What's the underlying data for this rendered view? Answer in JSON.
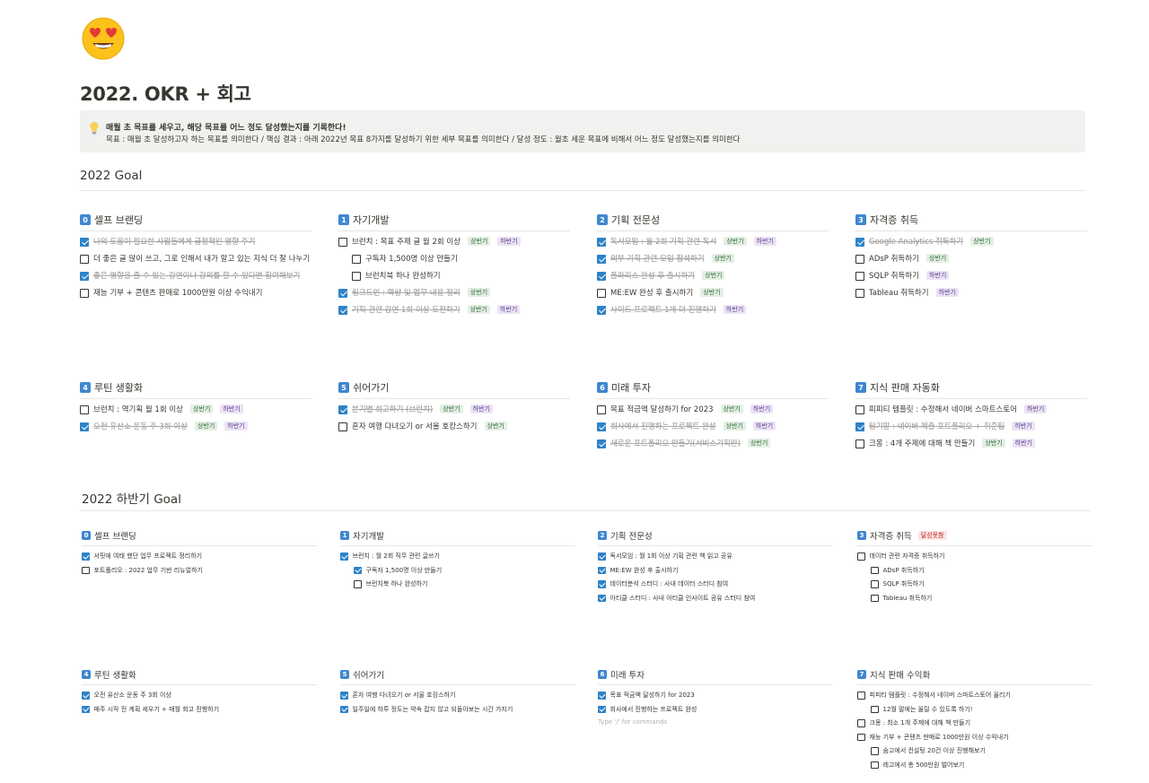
{
  "page": {
    "title": "2022. OKR + 회고",
    "icon": "heart-eyes-emoji"
  },
  "callout": {
    "icon": "lightbulb-icon",
    "line1": "매월 초 목표를 세우고, 해당 목표를 어느 정도 달성했는지를 기록한다!",
    "line2": "목표 : 매월 초 달성하고자 하는 목표를 의미한다 / 핵심 결과 : 아래 2022년 목표 8가지를 달성하기 위한 세부 목표를 의미한다 / 달성 정도 : 월초 세운 목표에 비해서 어느 정도 달성했는지를 의미한다"
  },
  "tags": {
    "first": "상반기",
    "second": "하반기",
    "fail": "달성못함"
  },
  "goal": {
    "title": "2022 Goal",
    "columns": [
      {
        "num": "0",
        "title": "셀프 브랜딩",
        "items": [
          {
            "text": "나의 도움이 필요한 사람들에게 긍정적인 영향 주기",
            "checked": true
          },
          {
            "text": "더 좋은 글 많이 쓰고, 그로 인해서 내가 알고 있는 지식 더 잘 나누기",
            "checked": false
          },
          {
            "text": "좋은 영향을 줄 수 있는 강연이나 강의를 할 수 있다면 참여해보기",
            "checked": true
          },
          {
            "text": "재능 기부 + 콘텐츠 판매로 1000만원 이상 수익내기",
            "checked": false
          }
        ]
      },
      {
        "num": "1",
        "title": "자기개발",
        "items": [
          {
            "text": "브런치 : 목표 주제 글 월 2회 이상",
            "checked": false,
            "tags": [
              "first",
              "second"
            ]
          },
          {
            "text": "구독자 1,500명 이상 만들기",
            "checked": false,
            "indent": true
          },
          {
            "text": "브런치북 하나 완성하기",
            "checked": false,
            "indent": true
          },
          {
            "text": "링크드인 : 역량 및 업무 내용 정리",
            "checked": true,
            "tags": [
              "first"
            ]
          },
          {
            "text": "기획 관련 강연 1회 이상 도전하기",
            "checked": true,
            "tags": [
              "first",
              "second"
            ]
          }
        ]
      },
      {
        "num": "2",
        "title": "기획 전문성",
        "items": [
          {
            "text": "독서모임 : 월 2회 기획 관련 독서",
            "checked": true,
            "tags": [
              "first",
              "second"
            ]
          },
          {
            "text": "외부 기획 관련 모임 참석하기",
            "checked": true,
            "tags": [
              "first"
            ]
          },
          {
            "text": "폴라리스 완성 후 출시하기",
            "checked": true,
            "tags": [
              "first"
            ]
          },
          {
            "text": "ME:EW 완성 후 출시하기",
            "checked": false,
            "tags": [
              "first"
            ]
          },
          {
            "text": "사이드 프로젝트 1개 더 진행하기",
            "checked": true,
            "tags": [
              "second"
            ]
          }
        ]
      },
      {
        "num": "3",
        "title": "자격증 취득",
        "items": [
          {
            "text": "Google Analytics 취득하기",
            "checked": true,
            "tags": [
              "first"
            ]
          },
          {
            "text": "ADsP 취득하기",
            "checked": false,
            "tags": [
              "first"
            ]
          },
          {
            "text": "SQLP 취득하기",
            "checked": false,
            "tags": [
              "second"
            ]
          },
          {
            "text": "Tableau 취득하기",
            "checked": false,
            "tags": [
              "second"
            ]
          }
        ]
      },
      {
        "num": "4",
        "title": "루틴 생활화",
        "items": [
          {
            "text": "브런치 : 역기획 월 1회 이상",
            "checked": false,
            "tags": [
              "first",
              "second"
            ]
          },
          {
            "text": "오전 유산소 운동 주 3회 이상",
            "checked": true,
            "tags": [
              "first",
              "second"
            ]
          }
        ]
      },
      {
        "num": "5",
        "title": "쉬어가기",
        "items": [
          {
            "text": "분기별 회고하기 (브런치)",
            "checked": true,
            "tags": [
              "first",
              "second"
            ]
          },
          {
            "text": "혼자 여행 다녀오기 or 서울 호캉스하기",
            "checked": false,
            "tags": [
              "first"
            ]
          }
        ]
      },
      {
        "num": "6",
        "title": "미래 투자",
        "items": [
          {
            "text": "목표 적금액 달성하기 for 2023",
            "checked": false,
            "tags": [
              "first",
              "second"
            ]
          },
          {
            "text": "회사에서 진행하는 프로젝트 완성",
            "checked": true,
            "tags": [
              "first",
              "second"
            ]
          },
          {
            "text": "새로운 포트폴리오 만들기(서비스기획만)",
            "checked": true,
            "tags": [
              "first"
            ]
          }
        ]
      },
      {
        "num": "7",
        "title": "지식 판매 자동화",
        "items": [
          {
            "text": "피피티 템플릿 : 수정해서 네이버 스마트스토어",
            "checked": false,
            "tags": [
              "second"
            ]
          },
          {
            "text": "탐기말 : 네이버 제출 포트폴리오 + 취준팁",
            "checked": true,
            "tags": [
              "second"
            ]
          },
          {
            "text": "크몽 : 4개 주제에 대해 책 만들기",
            "checked": false,
            "tags": [
              "first",
              "second"
            ]
          }
        ]
      }
    ]
  },
  "half": {
    "title": "2022 하반기 Goal",
    "columns": [
      {
        "num": "0",
        "title": "셀프 브랜딩",
        "items": [
          {
            "text": "서핏에 여태 했던 업무 프로젝트 정리하기",
            "checked": true
          },
          {
            "text": "포트폴리오 : 2022 업무 기반 리뉴얼하기",
            "checked": false
          }
        ]
      },
      {
        "num": "1",
        "title": "자기개발",
        "items": [
          {
            "text": "브런치 : 월 2회 직무 관련 글쓰기",
            "checked": true
          },
          {
            "text": "구독자 1,500명 이상 만들기",
            "checked": true,
            "indent": true
          },
          {
            "text": "브런치북 하나 완성하기",
            "checked": false,
            "indent": true
          }
        ]
      },
      {
        "num": "2",
        "title": "기획 전문성",
        "items": [
          {
            "text": "독서모임 : 월 1회 이상 기획 관련 책 읽고 공유",
            "checked": true
          },
          {
            "text": "ME:EW 완성 후 출시하기",
            "checked": true
          },
          {
            "text": "데이터분석 스터디 : 사내 데이터 스터디 참여",
            "checked": true
          },
          {
            "text": "아티클 스터디 : 사내 아티클 인사이트 공유 스터디 참여",
            "checked": true
          }
        ]
      },
      {
        "num": "3",
        "title": "자격증 취득",
        "badge": "fail",
        "items": [
          {
            "text": "데이터 관련 자격증 취득하기",
            "checked": false
          },
          {
            "text": "ADsP 취득하기",
            "checked": false,
            "indent": true
          },
          {
            "text": "SQLP 취득하기",
            "checked": false,
            "indent": true
          },
          {
            "text": "Tableau 취득하기",
            "checked": false,
            "indent": true
          }
        ]
      },
      {
        "num": "4",
        "title": "루틴 생활화",
        "items": [
          {
            "text": "오전 유산소 운동 주 3회 이상",
            "checked": true
          },
          {
            "text": "매주 시작 전 계획 세우기 + 매월 회고 진행하기",
            "checked": true
          }
        ]
      },
      {
        "num": "5",
        "title": "쉬어가기",
        "items": [
          {
            "text": "혼자 여행 다녀오기 or 서울 호캉스하기",
            "checked": true
          },
          {
            "text": "일주일에 하루 정도는 약속 잡지 않고 되돌아보는 시간 가지기",
            "checked": true
          }
        ]
      },
      {
        "num": "6",
        "title": "미래 투자",
        "hint": "Type '/' for commands",
        "items": [
          {
            "text": "목표 적금액 달성하기 for 2023",
            "checked": true
          },
          {
            "text": "회사에서 진행하는 프로젝트 완성",
            "checked": true
          }
        ]
      },
      {
        "num": "7",
        "title": "지식 판매 수익화",
        "items": [
          {
            "text": "피피티 템플릿 : 수정해서 네이버 스마트스토어 올리기",
            "checked": false
          },
          {
            "text": "12월 말에는 올릴 수 있도록 하기!",
            "checked": false,
            "indent": true
          },
          {
            "text": "크몽 : 최소 1개 주제에 대해 책 만들기",
            "checked": false
          },
          {
            "text": "재능 기부 + 콘텐츠 판매로 1000만원 이상 수익내기",
            "checked": false
          },
          {
            "text": "숨고에서 컨설팅 20건 이상 진행해보기",
            "checked": false,
            "indent": true
          },
          {
            "text": "레고에서 총 500만원 벌어보기",
            "checked": false,
            "indent": true
          }
        ]
      }
    ]
  }
}
